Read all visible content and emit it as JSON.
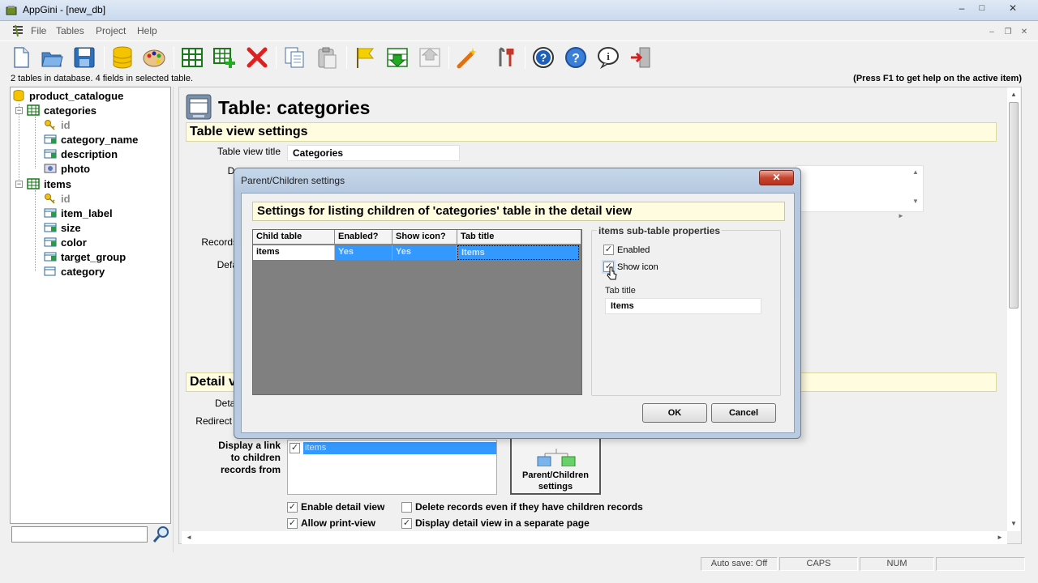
{
  "window": {
    "title": "AppGini - [new_db]",
    "minimize": "–",
    "restore": "□",
    "close": "✕"
  },
  "menu": {
    "items": [
      "File",
      "Tables",
      "Project",
      "Help"
    ],
    "mdi_min": "–",
    "mdi_restore": "❐",
    "mdi_close": "✕"
  },
  "toolbar": {
    "buttons": [
      "new-file-icon",
      "open-folder-icon",
      "save-icon",
      "database-icon",
      "palette-icon",
      "table-grid-icon",
      "add-table-icon",
      "delete-icon",
      "copy-icon",
      "paste-icon",
      "flag-icon",
      "move-down-icon",
      "move-up-icon",
      "magic-wand-icon",
      "tools-icon",
      "help-icon",
      "help-context-icon",
      "info-icon",
      "exit-icon"
    ]
  },
  "info": {
    "left": "2 tables in database. 4 fields in selected table.",
    "right": "(Press F1 to get help on the active item)"
  },
  "tree": {
    "root": "product_catalogue",
    "tables": [
      {
        "name": "categories",
        "fields": [
          {
            "name": "id",
            "type": "key"
          },
          {
            "name": "category_name",
            "type": "field"
          },
          {
            "name": "description",
            "type": "field"
          },
          {
            "name": "photo",
            "type": "image"
          }
        ]
      },
      {
        "name": "items",
        "fields": [
          {
            "name": "id",
            "type": "key"
          },
          {
            "name": "item_label",
            "type": "field"
          },
          {
            "name": "size",
            "type": "field"
          },
          {
            "name": "color",
            "type": "field"
          },
          {
            "name": "target_group",
            "type": "field"
          },
          {
            "name": "category",
            "type": "lookup"
          }
        ]
      }
    ]
  },
  "main": {
    "title": "Table: categories",
    "section1": "Table view settings",
    "table_view_title_label": "Table view title",
    "table_view_title_value": "Categories",
    "desc_label_partial": "De",
    "records_label_partial": "Records",
    "default_label_partial": "Defa",
    "section2_partial": "Detail v",
    "detail_label_partial": "Detai",
    "redirect_label_partial": "Redirect a",
    "display_link_label": "Display a link\nto children\nrecords from",
    "children_list_item": "items",
    "parent_children_btn": "Parent/Children settings",
    "checkboxes": [
      {
        "label": "Enable detail view",
        "checked": true
      },
      {
        "label": "Delete records even if they have children records",
        "checked": false
      },
      {
        "label": "Allow print-view",
        "checked": true
      },
      {
        "label": "Display detail view in a separate page",
        "checked": true
      }
    ]
  },
  "statusbar": {
    "autosave": "Auto save: Off",
    "caps": "CAPS",
    "num": "NUM"
  },
  "dialog": {
    "title": "Parent/Children settings",
    "header": "Settings for listing children of 'categories' table in the detail view",
    "grid_headers": [
      "Child table",
      "Enabled?",
      "Show icon?",
      "Tab title"
    ],
    "grid_rows": [
      [
        "items",
        "Yes",
        "Yes",
        "Items"
      ]
    ],
    "props_title": "items sub-table properties",
    "enabled_label": "Enabled",
    "enabled_checked": true,
    "show_icon_label": "Show icon",
    "show_icon_checked": true,
    "tab_title_label": "Tab title",
    "tab_title_value": "Items",
    "ok": "OK",
    "cancel": "Cancel",
    "close": "✕"
  }
}
